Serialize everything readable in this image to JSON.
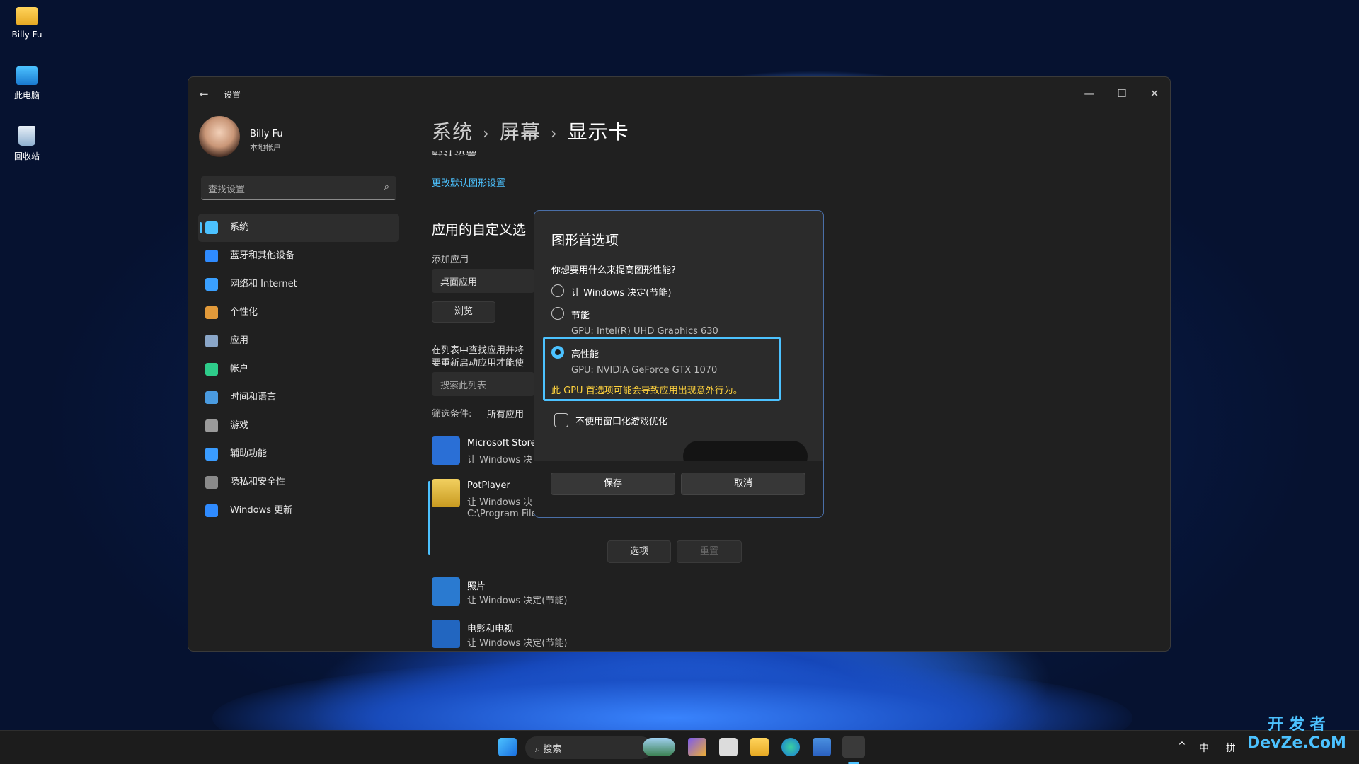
{
  "desktop": {
    "icons": [
      {
        "label": "Billy Fu"
      },
      {
        "label": "此电脑"
      },
      {
        "label": "回收站"
      }
    ]
  },
  "window": {
    "title": "设置",
    "controls": {
      "minimize": "—",
      "maximize": "☐",
      "close": "✕"
    }
  },
  "user": {
    "name": "Billy Fu",
    "account_type": "本地帐户"
  },
  "search": {
    "placeholder": "查找设置"
  },
  "sidebar": {
    "items": [
      {
        "label": "系统",
        "icon": "monitor-icon",
        "color": "#4cc2ff"
      },
      {
        "label": "蓝牙和其他设备",
        "icon": "bluetooth-icon",
        "color": "#2f8bff"
      },
      {
        "label": "网络和 Internet",
        "icon": "wifi-icon",
        "color": "#3aa0ff"
      },
      {
        "label": "个性化",
        "icon": "brush-icon",
        "color": "#e29a3a"
      },
      {
        "label": "应用",
        "icon": "apps-icon",
        "color": "#8aa6c8"
      },
      {
        "label": "帐户",
        "icon": "person-icon",
        "color": "#2ecc8a"
      },
      {
        "label": "时间和语言",
        "icon": "globe-clock-icon",
        "color": "#4a9be0"
      },
      {
        "label": "游戏",
        "icon": "gamepad-icon",
        "color": "#9a9a9a"
      },
      {
        "label": "辅助功能",
        "icon": "accessibility-icon",
        "color": "#3a9cff"
      },
      {
        "label": "隐私和安全性",
        "icon": "shield-icon",
        "color": "#8a8a8a"
      },
      {
        "label": "Windows 更新",
        "icon": "update-icon",
        "color": "#2f8bff"
      }
    ]
  },
  "breadcrumb": {
    "items": [
      "系统",
      "屏幕",
      "显示卡"
    ],
    "separator": "›"
  },
  "content": {
    "default_heading_cut": "默认设置",
    "change_default_link": "更改默认图形设置",
    "custom_heading": "应用的自定义选",
    "add_app_label": "添加应用",
    "app_type_value": "桌面应用",
    "browse_button": "浏览",
    "info_line1": "在列表中查找应用并将",
    "info_line2": "要重新启动应用才能使",
    "search_list_placeholder": "搜索此列表",
    "filter_label": "筛选条件:",
    "filter_value": "所有应用",
    "apps": [
      {
        "name": "Microsoft Store",
        "sub": "让 Windows 决",
        "icon": "store-icon",
        "color": "#2a6fd6"
      },
      {
        "name": "PotPlayer",
        "sub": "让 Windows 决",
        "path": "C:\\Program File",
        "icon": "potplayer-icon",
        "color": "#e8b840"
      },
      {
        "name": "照片",
        "sub": "让 Windows 决定(节能)",
        "icon": "photos-icon",
        "color": "#2a7ad0"
      },
      {
        "name": "电影和电视",
        "sub": "让 Windows 决定(节能)",
        "icon": "movies-icon",
        "color": "#2266c0"
      }
    ],
    "options_button": "选项",
    "reset_button": "重置"
  },
  "dialog": {
    "title": "图形首选项",
    "question": "你想要用什么来提高图形性能?",
    "options": [
      {
        "label": "让 Windows 决定(节能)",
        "selected": false
      },
      {
        "label": "节能",
        "sub": "GPU: Intel(R) UHD Graphics 630",
        "selected": false
      },
      {
        "label": "高性能",
        "sub": "GPU: NVIDIA GeForce GTX 1070",
        "selected": true
      }
    ],
    "warning": "此 GPU 首选项可能会导致应用出现意外行为。",
    "checkbox_label": "不使用窗口化游戏优化",
    "checkbox_checked": false,
    "save_button": "保存",
    "cancel_button": "取消"
  },
  "taskbar": {
    "search_label": "搜索",
    "tray": {
      "chevron": "^",
      "ime_lang": "中",
      "ime_mode": "拼"
    }
  },
  "watermark": {
    "line1": "开 发 者",
    "line2": "DevZe.CoM"
  }
}
